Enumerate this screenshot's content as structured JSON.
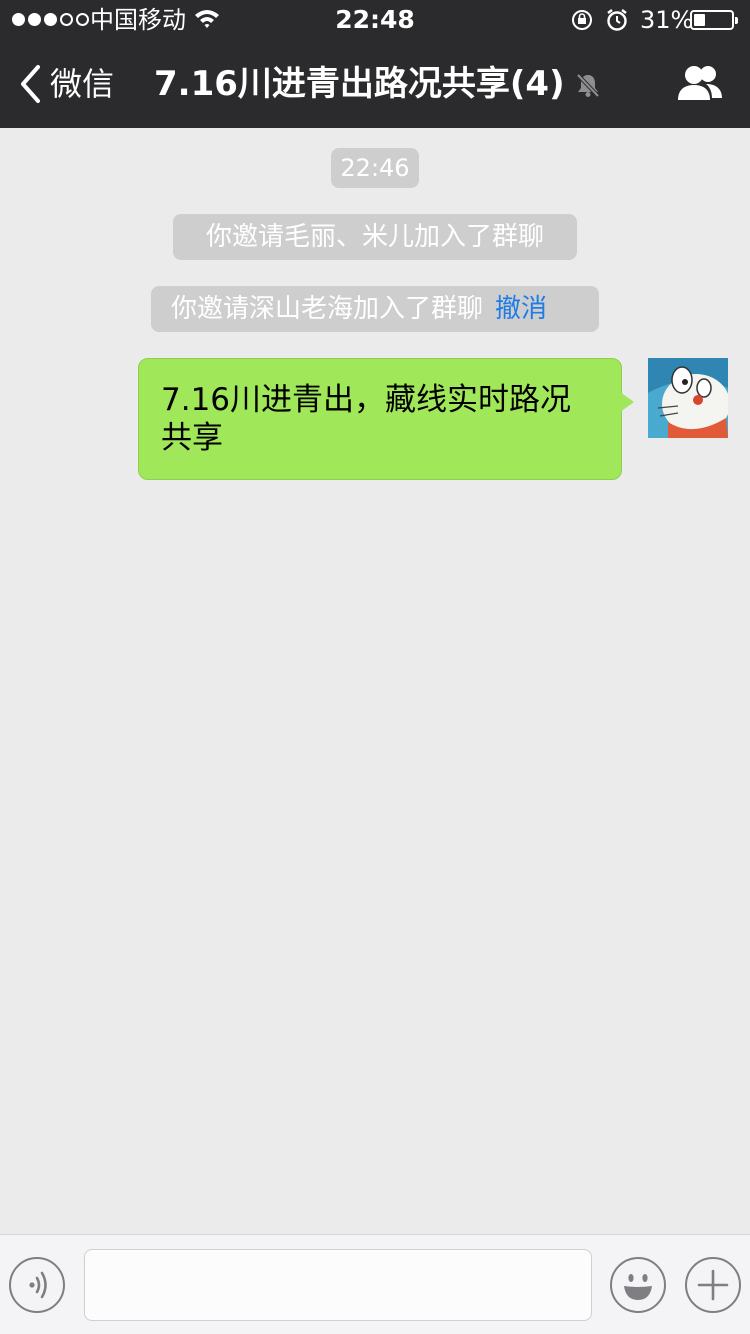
{
  "status_bar": {
    "carrier": "中国移动",
    "time": "22:48",
    "battery_percent": "31%",
    "signal_strength": 3,
    "battery_level": 0.31
  },
  "nav": {
    "back_label": "微信",
    "title": "7.16川进青出路况共享(4)",
    "icons": [
      "chevron-left-icon",
      "mute-bell-icon",
      "group-members-icon"
    ]
  },
  "chat": {
    "timestamp": "22:46",
    "system_messages": [
      {
        "text": "你邀请毛丽、米儿加入了群聊"
      },
      {
        "text": "你邀请深山老海加入了群聊",
        "action": "撤消"
      }
    ],
    "messages": [
      {
        "sender": "me",
        "text": "7.16川进青出，藏线实时路况共享",
        "bubble_color": "#a0e75a"
      }
    ]
  },
  "toolbar": {
    "icons": [
      "voice-icon",
      "emoji-icon",
      "plus-icon"
    ],
    "input_value": ""
  },
  "colors": {
    "header_bg": "#2b2b2d",
    "chat_bg": "#ebebeb",
    "link": "#1f7ce6",
    "bubble_me": "#a0e75a"
  }
}
